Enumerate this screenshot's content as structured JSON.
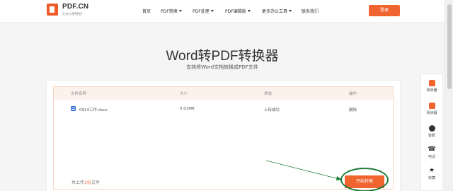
{
  "header": {
    "brand": "PDF.CN",
    "slogan": "让办公更轻松!",
    "nav": [
      {
        "label": "首页",
        "dropdown": false
      },
      {
        "label": "PDF转换",
        "dropdown": true
      },
      {
        "label": "PDF处理",
        "dropdown": true
      },
      {
        "label": "PDF编辑版",
        "dropdown": true
      },
      {
        "label": "更多办公工具",
        "dropdown": true
      },
      {
        "label": "联系我们",
        "dropdown": false
      }
    ],
    "login_label": "登录"
  },
  "main": {
    "title": "Word转PDF转换器",
    "subtitle": "支持将Word文档转换成PDF文件"
  },
  "table": {
    "columns": [
      "文件名称",
      "大小",
      "状态",
      "操作"
    ],
    "rows": [
      {
        "name": "0914工作.docx",
        "size": "0.01MB",
        "status": "上传成功",
        "action": "删除"
      }
    ],
    "footer_prefix": "共上传",
    "footer_count": "1份",
    "footer_suffix": "文件",
    "start_label": "开始转换"
  },
  "sidebar": {
    "items": [
      {
        "label": "转换器",
        "icon": "converter-icon"
      },
      {
        "label": "阅读器",
        "icon": "reader-icon"
      },
      {
        "label": "客服",
        "icon": "chat-icon"
      },
      {
        "label": "电话",
        "icon": "phone-icon"
      },
      {
        "label": "收藏",
        "icon": "star-icon"
      }
    ]
  },
  "colors": {
    "accent": "#f06430",
    "annotation": "#1f7a38"
  }
}
